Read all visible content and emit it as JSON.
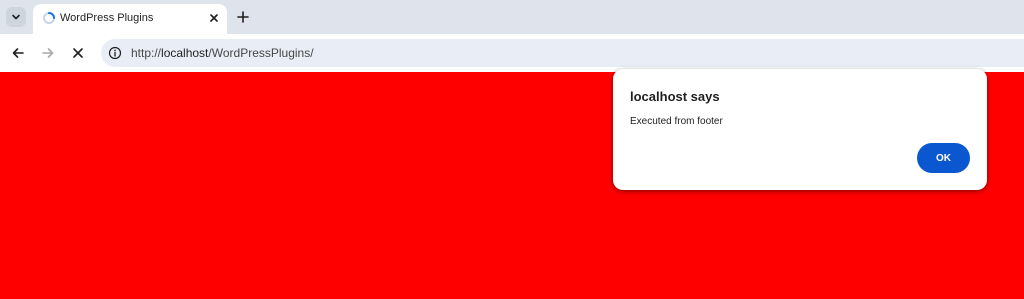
{
  "browser": {
    "tab": {
      "title": "WordPress Plugins",
      "favicon": "loading-spinner-icon"
    },
    "address_bar": {
      "scheme": "http://",
      "host": "localhost",
      "path": "/WordPressPlugins/"
    },
    "icons": {
      "tab_search": "chevron-down-icon",
      "tab_close": "close-icon",
      "new_tab": "plus-icon",
      "back": "back-arrow-icon",
      "forward": "forward-arrow-icon",
      "stop": "stop-icon",
      "site_info": "info-icon"
    }
  },
  "page": {
    "background_color": "#ff0000"
  },
  "alert": {
    "title": "localhost says",
    "message": "Executed from footer",
    "ok_label": "OK",
    "ok_color": "#0b57d0"
  }
}
